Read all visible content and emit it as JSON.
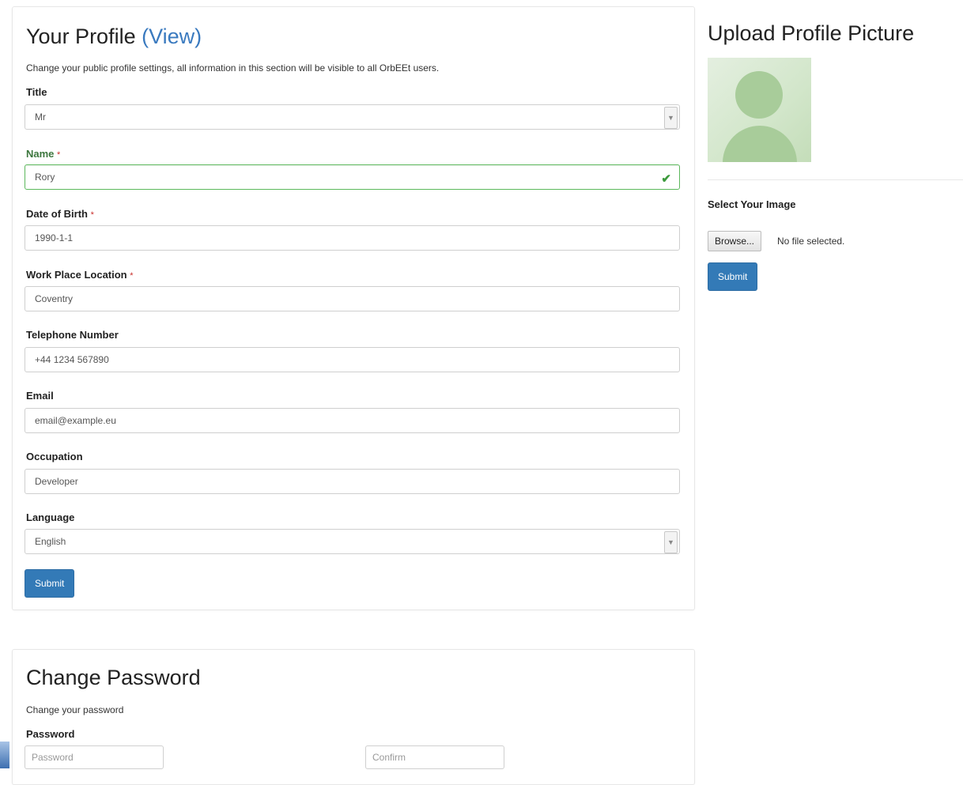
{
  "profile": {
    "title": "Your Profile",
    "view_link": "(View)",
    "description": "Change your public profile settings, all information in this section will be visible to all OrbEEt users.",
    "fields": {
      "title": {
        "label": "Title",
        "value": "Mr"
      },
      "name": {
        "label": "Name",
        "required": "*",
        "value": "Rory"
      },
      "dob": {
        "label": "Date of Birth",
        "required": "*",
        "value": "1990-1-1"
      },
      "workplace": {
        "label": "Work Place Location",
        "required": "*",
        "value": "Coventry"
      },
      "telephone": {
        "label": "Telephone Number",
        "value": "+44 1234 567890"
      },
      "email": {
        "label": "Email",
        "value": "email@example.eu"
      },
      "occupation": {
        "label": "Occupation",
        "value": "Developer"
      },
      "language": {
        "label": "Language",
        "value": "English"
      }
    },
    "submit_label": "Submit"
  },
  "password": {
    "title": "Change Password",
    "description": "Change your password",
    "label": "Password",
    "password_placeholder": "Password",
    "confirm_placeholder": "Confirm"
  },
  "upload": {
    "title": "Upload Profile Picture",
    "select_label": "Select Your Image",
    "browse_label": "Browse...",
    "file_status": "No file selected.",
    "submit_label": "Submit"
  },
  "icons": {
    "valid": "check-icon",
    "select_caret": "chevron-down-icon",
    "avatar": "user-avatar-icon"
  },
  "colors": {
    "primary": "#337ab7",
    "link": "#3a7abf",
    "success": "#3c763d",
    "required": "#c9302c"
  }
}
